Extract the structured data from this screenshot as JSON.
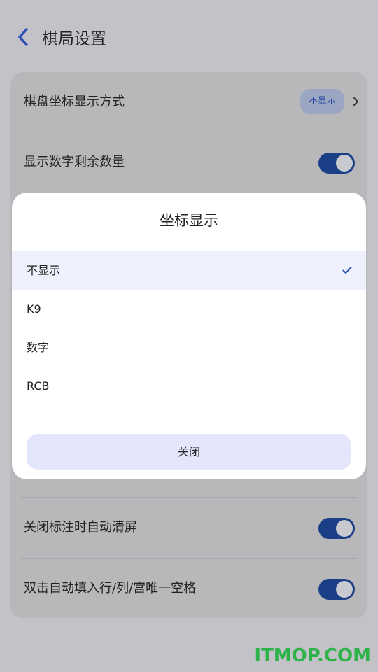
{
  "header": {
    "title": "棋局设置"
  },
  "settings": {
    "items": [
      {
        "label": "棋盘坐标显示方式",
        "value": "不显示"
      },
      {
        "label": "显示数字剩余数量"
      },
      {
        "label": "关闭标注时自动清屏"
      },
      {
        "label": "双击自动填入行/列/宫唯一空格"
      }
    ]
  },
  "dialog": {
    "title": "坐标显示",
    "options": [
      {
        "label": "不显示"
      },
      {
        "label": "K9"
      },
      {
        "label": "数字"
      },
      {
        "label": "RCB"
      }
    ],
    "selected_index": 0,
    "close_label": "关闭"
  },
  "toggles": {
    "all_on": true
  },
  "colors": {
    "accent": "#1b3f86",
    "selected_bg": "#eef0fb",
    "button_bg": "#e4e6fb",
    "watermark": "#2db34a"
  },
  "watermark": "ITMOP.COM"
}
